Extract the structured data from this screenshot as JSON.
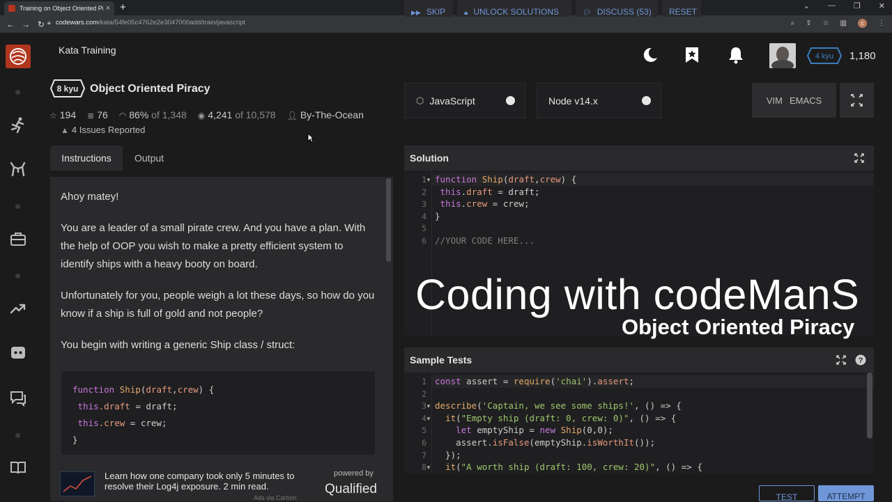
{
  "browser": {
    "tab_title": "Training on Object Oriented Pira",
    "url_domain": "codewars.com",
    "url_path": "/kata/54fe05c4762e2e3047000add/train/javascript",
    "profile_initial": "c"
  },
  "header": {
    "nav_label": "Kata Training",
    "user_rank": "4 kyu",
    "user_honor": "1,180"
  },
  "kata": {
    "rank": "8 kyu",
    "title": "Object Oriented Piracy",
    "stars": "194",
    "collections": "76",
    "satisfaction": "86%",
    "satisfaction_of": "of 1,348",
    "completed": "4,241",
    "completed_of": "of 10,578",
    "author": "By-The-Ocean",
    "issues": "4 Issues Reported"
  },
  "tabs": {
    "instructions": "Instructions",
    "output": "Output"
  },
  "instructions": {
    "p1": "Ahoy matey!",
    "p2": "You are a leader of a small pirate crew. And you have a plan. With the help of OOP you wish to make a pretty efficient system to identify ships with a heavy booty on board.",
    "p3": "Unfortunately for you, people weigh a lot these days, so how do you know if a ship is full of gold and not people?",
    "p4": "You begin with writing a generic Ship class / struct:",
    "code": {
      "l1_kw": "function",
      "l1_fn": "Ship",
      "l1_rest_open": "(",
      "l1_p1": "draft",
      "l1_comma": ",",
      "l1_p2": "crew",
      "l1_close": ") {",
      "l2_this": "this",
      "l2_prop": ".draft",
      "l2_rest": " = draft;",
      "l3_this": "this",
      "l3_prop": ".crew",
      "l3_rest": " = crew;",
      "l4": "}"
    }
  },
  "ad": {
    "text": "Learn how one company took only 5 minutes to resolve their Log4j exposure. 2 min read.",
    "powered": "powered by",
    "brand": "Qualified",
    "via": "Ads via Carbon"
  },
  "editor": {
    "language": "JavaScript",
    "runtime": "Node v14.x",
    "mode_vim": "VIM",
    "mode_emacs": "EMACS",
    "solution_label": "Solution",
    "solution_lines": [
      "function Ship(draft,crew) {",
      " this.draft = draft;",
      " this.crew = crew;",
      "}",
      "",
      "//YOUR CODE HERE..."
    ],
    "sample_tests_label": "Sample Tests",
    "test_lines": [
      "const assert = require('chai').assert;",
      "",
      "describe('Captain, we see some ships!', () => {",
      "  it(\"Empty ship (draft: 0, crew: 0)\", () => {",
      "    let emptyShip = new Ship(0,0);",
      "    assert.isFalse(emptyShip.isWorthIt());",
      "  });",
      "  it(\"A worth ship (draft: 100, crew: 20)\", () => {"
    ]
  },
  "watermark": {
    "line1": "Coding with codeManS",
    "line2": "Object Oriented Piracy"
  },
  "actions": {
    "skip": "Skip",
    "unlock": "Unlock Solutions",
    "discuss": "Discuss (53)",
    "reset": "Reset",
    "test": "Test",
    "attempt": "Attempt"
  }
}
